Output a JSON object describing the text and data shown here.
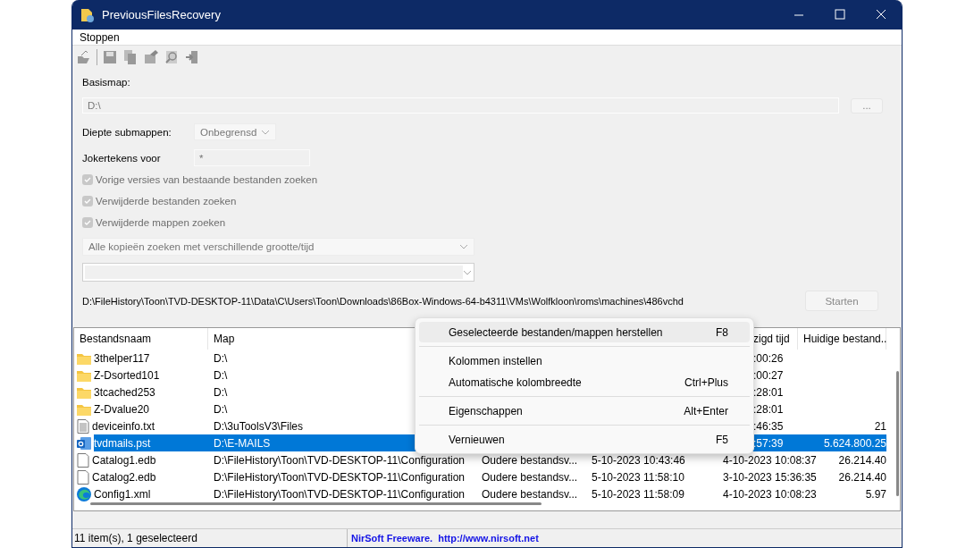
{
  "window": {
    "title": "PreviousFilesRecovery"
  },
  "menu_bar": [
    "Stoppen"
  ],
  "form": {
    "base_folder_label": "Basismap:",
    "base_folder_value": "D:\\",
    "browse_button": "...",
    "depth_label": "Diepte submappen:",
    "depth_value": "Onbegrensd",
    "wildcard_label": "Jokertekens voor",
    "wildcard_value": "*",
    "checkboxes": [
      {
        "label": "Vorige versies van bestaande bestanden zoeken",
        "checked": true,
        "disabled": true
      },
      {
        "label": "Verwijderde bestanden zoeken",
        "checked": true,
        "disabled": true
      },
      {
        "label": "Verwijderde mappen zoeken",
        "checked": true,
        "disabled": true
      }
    ],
    "mode_value": "Alle kopieën zoeken met verschillende grootte/tijd",
    "current_path": "D:\\FileHistory\\Toon\\TVD-DESKTOP-11\\Data\\C\\Users\\Toon\\Downloads\\86Box-Windows-64-b4311\\VMs\\Wolfkloon\\roms\\machines\\486vchd",
    "start_button": "Starten"
  },
  "table": {
    "columns": [
      "Bestandsnaam",
      "Map",
      "",
      "",
      "zigd tijd",
      "Huidige bestand.."
    ],
    "rows": [
      {
        "kind": "folder",
        "selected": false,
        "cells": [
          "3thelper117",
          "D:\\",
          "",
          "",
          ":00:26",
          ""
        ]
      },
      {
        "kind": "folder",
        "selected": false,
        "cells": [
          "Z-Dsorted101",
          "D:\\",
          "",
          "",
          ":00:27",
          ""
        ]
      },
      {
        "kind": "folder",
        "selected": false,
        "cells": [
          "3tcached253",
          "D:\\",
          "",
          "",
          ":28:01",
          ""
        ]
      },
      {
        "kind": "folder",
        "selected": false,
        "cells": [
          "Z-Dvalue20",
          "D:\\",
          "",
          "",
          ":28:01",
          ""
        ]
      },
      {
        "kind": "text",
        "selected": false,
        "cells": [
          "deviceinfo.txt",
          "D:\\3uToolsV3\\Files",
          "",
          "",
          ":46:35",
          "21"
        ]
      },
      {
        "kind": "mail",
        "selected": true,
        "cells": [
          "tvdmails.pst",
          "D:\\E-MAILS",
          "",
          "",
          ":57:39",
          "5.624.800.25"
        ]
      },
      {
        "kind": "file",
        "selected": false,
        "cells": [
          "Catalog1.edb",
          "D:\\FileHistory\\Toon\\TVD-DESKTOP-11\\Configuration",
          "Oudere bestandsv...",
          "5-10-2023 10:43:46",
          "4-10-2023 10:08:37",
          "26.214.40"
        ]
      },
      {
        "kind": "file",
        "selected": false,
        "cells": [
          "Catalog2.edb",
          "D:\\FileHistory\\Toon\\TVD-DESKTOP-11\\Configuration",
          "Oudere bestandsv...",
          "5-10-2023 11:58:10",
          "3-10-2023 15:36:35",
          "26.214.40"
        ]
      },
      {
        "kind": "web",
        "selected": false,
        "cells": [
          "Config1.xml",
          "D:\\FileHistory\\Toon\\TVD-DESKTOP-11\\Configuration",
          "Oudere bestandsv...",
          "5-10-2023 11:58:09",
          "4-10-2023 10:08:23",
          "5.97"
        ]
      }
    ]
  },
  "context_menu": [
    {
      "kind": "item",
      "label": "Geselecteerde bestanden/mappen herstellen",
      "shortcut": "F8",
      "selected": true
    },
    {
      "kind": "separator"
    },
    {
      "kind": "item",
      "label": "Kolommen instellen",
      "selected": false
    },
    {
      "kind": "item",
      "label": "Automatische kolombreedte",
      "shortcut": "Ctrl+Plus",
      "selected": false
    },
    {
      "kind": "separator"
    },
    {
      "kind": "item",
      "label": "Eigenschappen",
      "shortcut": "Alt+Enter",
      "selected": false
    },
    {
      "kind": "separator"
    },
    {
      "kind": "item",
      "label": "Vernieuwen",
      "shortcut": "F5",
      "selected": false
    }
  ],
  "status_bar": {
    "count": "11 item(s), 1 geselecteerd",
    "credit": "NirSoft Freeware.  http://www.nirsoft.net"
  }
}
